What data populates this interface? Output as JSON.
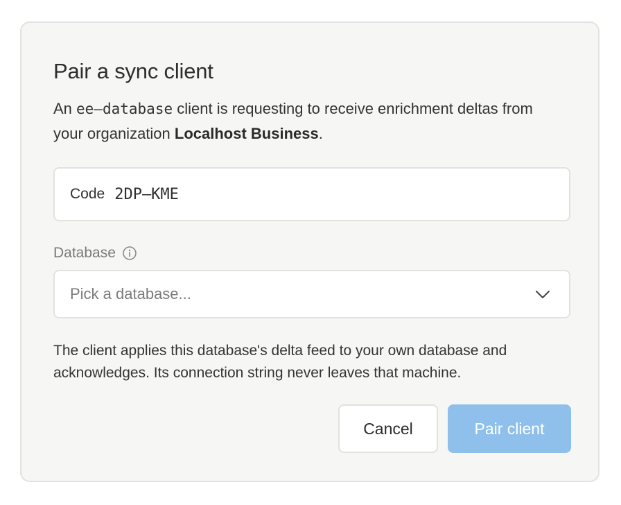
{
  "dialog": {
    "title": "Pair a sync client",
    "description": {
      "prefix": "An ",
      "client_name": "ee–database",
      "middle": " client is requesting to receive enrichment deltas from your organization ",
      "organization": "Localhost Business",
      "suffix": "."
    },
    "code": {
      "label": "Code",
      "value": "2DP–KME"
    },
    "database": {
      "label": "Database",
      "info_icon": "info-icon",
      "placeholder": "Pick a database...",
      "chevron_icon": "chevron-down-icon"
    },
    "note": "The client applies this database's delta feed to your own database and acknowledges. Its connection string never leaves that machine.",
    "buttons": {
      "cancel": "Cancel",
      "pair": "Pair client"
    }
  }
}
